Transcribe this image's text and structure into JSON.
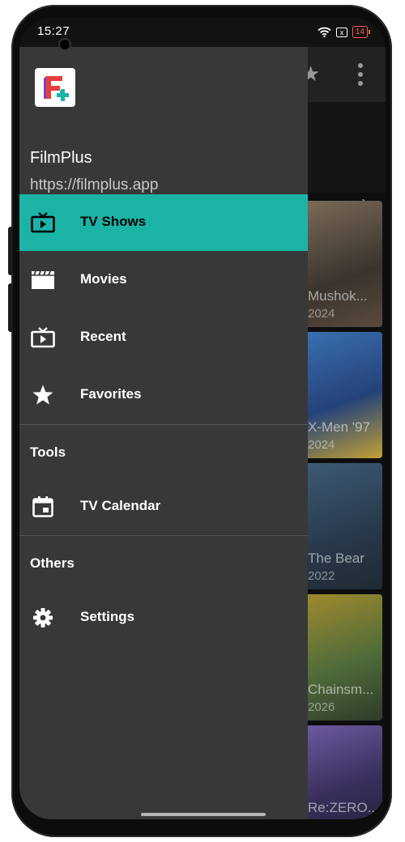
{
  "status_bar": {
    "time": "15:27",
    "battery": "14",
    "sim_icon": "x"
  },
  "drawer": {
    "app_name": "FilmPlus",
    "app_url": "https://filmplus.app",
    "items": [
      {
        "label": "TV Shows",
        "icon": "tv-icon",
        "active": true
      },
      {
        "label": "Movies",
        "icon": "clapperboard-icon"
      },
      {
        "label": "Recent",
        "icon": "tv-recent-icon"
      },
      {
        "label": "Favorites",
        "icon": "star-icon"
      }
    ],
    "sections": {
      "tools": {
        "title": "Tools",
        "items": [
          {
            "label": "TV Calendar",
            "icon": "calendar-icon"
          }
        ]
      },
      "others": {
        "title": "Others",
        "items": [
          {
            "label": "Settings",
            "icon": "gear-icon"
          }
        ]
      }
    }
  },
  "background_posters": [
    {
      "title": "Mushok...",
      "year": "2024"
    },
    {
      "title": "X-Men '97",
      "year": "2024"
    },
    {
      "title": "The Bear",
      "year": "2022"
    },
    {
      "title": "Chainsm...",
      "year": "2026"
    },
    {
      "title": "Re:ZERO...",
      "year": ""
    }
  ],
  "colors": {
    "accent": "#1ab3a6",
    "drawer_bg": "#383838"
  }
}
